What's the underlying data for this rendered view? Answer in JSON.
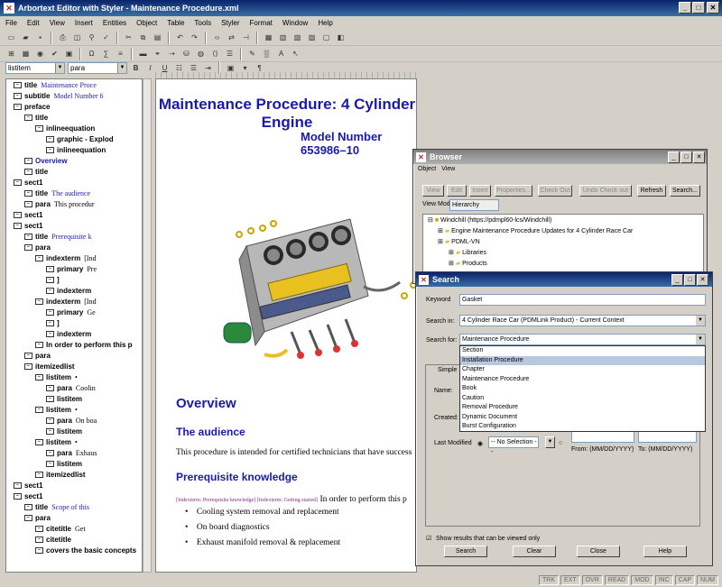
{
  "window": {
    "title": "Arbortext Editor with Styler - Maintenance Procedure.xml",
    "menu": [
      "File",
      "Edit",
      "View",
      "Insert",
      "Entities",
      "Object",
      "Table",
      "Tools",
      "Styler",
      "Format",
      "Window",
      "Help"
    ]
  },
  "toolbar": {
    "element_combo": "listitem",
    "style_combo": "para",
    "bold": "B",
    "italic": "I",
    "underline": "U",
    "pilcrow": "¶"
  },
  "tree": [
    {
      "tag": "title",
      "text": "Maintenance Proce",
      "cls": "bl",
      "indent": 0
    },
    {
      "tag": "subtitle",
      "text": "Model Number 6",
      "cls": "bl",
      "indent": 0
    },
    {
      "tag": "preface",
      "text": "",
      "indent": 0
    },
    {
      "tag": "title",
      "text": "",
      "indent": 1
    },
    {
      "tag": "inlineequation",
      "text": "",
      "indent": 2
    },
    {
      "tag": "graphic - Explod",
      "text": "",
      "indent": 3
    },
    {
      "tag": "inlineequation",
      "text": "",
      "indent": 3
    },
    {
      "tag": "Overview",
      "text": "",
      "cls": "bl",
      "indent": 1
    },
    {
      "tag": "title",
      "text": "",
      "indent": 1
    },
    {
      "tag": "sect1",
      "text": "",
      "indent": 0
    },
    {
      "tag": "title",
      "text": "The audience",
      "cls": "bl",
      "indent": 1
    },
    {
      "tag": "para",
      "text": "This procedur",
      "indent": 1
    },
    {
      "tag": "sect1",
      "text": "",
      "indent": 0
    },
    {
      "tag": "sect1",
      "text": "",
      "indent": 0
    },
    {
      "tag": "title",
      "text": "Prerequisite k",
      "cls": "bl",
      "indent": 1
    },
    {
      "tag": "para",
      "text": "",
      "indent": 1
    },
    {
      "tag": "indexterm",
      "text": "[Ind",
      "indent": 2
    },
    {
      "tag": "primary",
      "text": "Pre",
      "indent": 3
    },
    {
      "tag": "]",
      "text": "",
      "indent": 3
    },
    {
      "tag": "indexterm",
      "text": "",
      "indent": 3
    },
    {
      "tag": "indexterm",
      "text": "[Ind",
      "indent": 2
    },
    {
      "tag": "primary",
      "text": "Ge",
      "indent": 3
    },
    {
      "tag": "]",
      "text": "",
      "indent": 3
    },
    {
      "tag": "indexterm",
      "text": "",
      "indent": 3
    },
    {
      "tag": "In order to perform this p",
      "text": "",
      "indent": 2
    },
    {
      "tag": "para",
      "text": "",
      "indent": 1
    },
    {
      "tag": "itemizedlist",
      "text": "",
      "indent": 1
    },
    {
      "tag": "listitem",
      "text": "•",
      "indent": 2
    },
    {
      "tag": "para",
      "text": "Coolin",
      "indent": 3
    },
    {
      "tag": "listitem",
      "text": "",
      "indent": 3
    },
    {
      "tag": "listitem",
      "text": "•",
      "indent": 2
    },
    {
      "tag": "para",
      "text": "On boa",
      "indent": 3
    },
    {
      "tag": "listitem",
      "text": "",
      "indent": 3
    },
    {
      "tag": "listitem",
      "text": "•",
      "indent": 2
    },
    {
      "tag": "para",
      "text": "Exhaus",
      "indent": 3
    },
    {
      "tag": "listitem",
      "text": "",
      "indent": 3
    },
    {
      "tag": "itemizedlist",
      "text": "",
      "indent": 2
    },
    {
      "tag": "sect1",
      "text": "",
      "indent": 0
    },
    {
      "tag": "sect1",
      "text": "",
      "indent": 0
    },
    {
      "tag": "title",
      "text": "Scope of this",
      "cls": "bl",
      "indent": 1
    },
    {
      "tag": "para",
      "text": "",
      "indent": 1
    },
    {
      "tag": "citetitle",
      "text": "Get",
      "indent": 2
    },
    {
      "tag": "citetitle",
      "text": "",
      "indent": 2
    },
    {
      "tag": "covers the basic concepts",
      "text": "",
      "indent": 2
    }
  ],
  "document": {
    "title": "Maintenance Procedure: 4 Cylinder Engine",
    "subtitle": "Model Number 653986–10",
    "overview": "Overview",
    "audience_heading": "The audience",
    "audience_para": "This procedure is intended for certified technicians that have success",
    "prereq_heading": "Prerequisite knowledge",
    "prereq_index": "[Indexterm: Prerequisite knowledge] [Indexterm: Getting started]",
    "prereq_para": "In order to perform this p",
    "bullets": [
      "Cooling system removal and replacement",
      "On board diagnostics",
      "Exhaust manifold removal & replacement"
    ]
  },
  "browser": {
    "title": "Browser",
    "menu": [
      "Object",
      "View"
    ],
    "buttons": [
      "View",
      "Edit",
      "Insert",
      "Properties...",
      "Check Out",
      "Undo Check out",
      "Refresh",
      "Search..."
    ],
    "view_mode_label": "View Mode",
    "view_mode_value": "Hierarchy",
    "tree": [
      "Windchill (https://pdmpl60-lcs/Windchill)",
      "Engine Maintenance Procedure Updates for 4 Cylinder Race Car",
      "PDML-VN",
      "Libraries",
      "Products"
    ]
  },
  "search": {
    "title": "Search",
    "keyword_label": "Keyword",
    "keyword_value": "Gasket",
    "search_in_label": "Search in:",
    "search_in_value": "4 Cylinder Race Car (PDMLink Product) - Current Context",
    "search_for_label": "Search for:",
    "search_for_value": "Maintenance Procedure",
    "options": [
      "Section",
      "Installation Procedure",
      "Chapter",
      "Maintenance Procedure",
      "Book",
      "Caution",
      "Removal Procedure",
      "Dynamic Document",
      "Burst Configuration"
    ],
    "selected_option_index": 1,
    "tab_simple": "Simple",
    "name_label": "Name:",
    "created_label": "Created:",
    "last_modified_label": "Last Modified",
    "no_selection": "-- No Selection --",
    "from_label": "From: (MM/DD/YYYY)",
    "to_label": "To: (MM/DD/YYYY)",
    "show_results_label": "Show results that can be viewed only",
    "buttons": {
      "search": "Search",
      "clear": "Clear",
      "close": "Close",
      "help": "Help"
    }
  },
  "statusbar": [
    "TRK",
    "EXT",
    "OVR",
    "READ",
    "MOD",
    "INC",
    "CAP",
    "NUM"
  ]
}
